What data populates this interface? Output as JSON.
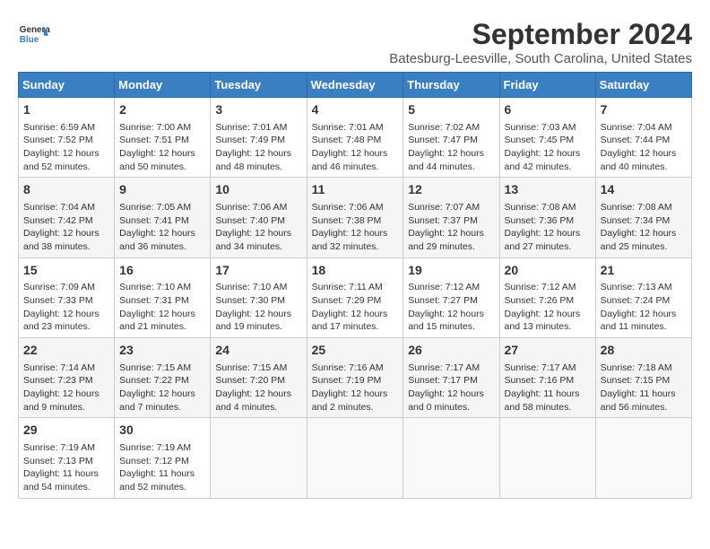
{
  "header": {
    "logo_line1": "General",
    "logo_line2": "Blue",
    "title": "September 2024",
    "subtitle": "Batesburg-Leesville, South Carolina, United States"
  },
  "days_of_week": [
    "Sunday",
    "Monday",
    "Tuesday",
    "Wednesday",
    "Thursday",
    "Friday",
    "Saturday"
  ],
  "weeks": [
    [
      {
        "day": "1",
        "info": "Sunrise: 6:59 AM\nSunset: 7:52 PM\nDaylight: 12 hours\nand 52 minutes."
      },
      {
        "day": "2",
        "info": "Sunrise: 7:00 AM\nSunset: 7:51 PM\nDaylight: 12 hours\nand 50 minutes."
      },
      {
        "day": "3",
        "info": "Sunrise: 7:01 AM\nSunset: 7:49 PM\nDaylight: 12 hours\nand 48 minutes."
      },
      {
        "day": "4",
        "info": "Sunrise: 7:01 AM\nSunset: 7:48 PM\nDaylight: 12 hours\nand 46 minutes."
      },
      {
        "day": "5",
        "info": "Sunrise: 7:02 AM\nSunset: 7:47 PM\nDaylight: 12 hours\nand 44 minutes."
      },
      {
        "day": "6",
        "info": "Sunrise: 7:03 AM\nSunset: 7:45 PM\nDaylight: 12 hours\nand 42 minutes."
      },
      {
        "day": "7",
        "info": "Sunrise: 7:04 AM\nSunset: 7:44 PM\nDaylight: 12 hours\nand 40 minutes."
      }
    ],
    [
      {
        "day": "8",
        "info": "Sunrise: 7:04 AM\nSunset: 7:42 PM\nDaylight: 12 hours\nand 38 minutes."
      },
      {
        "day": "9",
        "info": "Sunrise: 7:05 AM\nSunset: 7:41 PM\nDaylight: 12 hours\nand 36 minutes."
      },
      {
        "day": "10",
        "info": "Sunrise: 7:06 AM\nSunset: 7:40 PM\nDaylight: 12 hours\nand 34 minutes."
      },
      {
        "day": "11",
        "info": "Sunrise: 7:06 AM\nSunset: 7:38 PM\nDaylight: 12 hours\nand 32 minutes."
      },
      {
        "day": "12",
        "info": "Sunrise: 7:07 AM\nSunset: 7:37 PM\nDaylight: 12 hours\nand 29 minutes."
      },
      {
        "day": "13",
        "info": "Sunrise: 7:08 AM\nSunset: 7:36 PM\nDaylight: 12 hours\nand 27 minutes."
      },
      {
        "day": "14",
        "info": "Sunrise: 7:08 AM\nSunset: 7:34 PM\nDaylight: 12 hours\nand 25 minutes."
      }
    ],
    [
      {
        "day": "15",
        "info": "Sunrise: 7:09 AM\nSunset: 7:33 PM\nDaylight: 12 hours\nand 23 minutes."
      },
      {
        "day": "16",
        "info": "Sunrise: 7:10 AM\nSunset: 7:31 PM\nDaylight: 12 hours\nand 21 minutes."
      },
      {
        "day": "17",
        "info": "Sunrise: 7:10 AM\nSunset: 7:30 PM\nDaylight: 12 hours\nand 19 minutes."
      },
      {
        "day": "18",
        "info": "Sunrise: 7:11 AM\nSunset: 7:29 PM\nDaylight: 12 hours\nand 17 minutes."
      },
      {
        "day": "19",
        "info": "Sunrise: 7:12 AM\nSunset: 7:27 PM\nDaylight: 12 hours\nand 15 minutes."
      },
      {
        "day": "20",
        "info": "Sunrise: 7:12 AM\nSunset: 7:26 PM\nDaylight: 12 hours\nand 13 minutes."
      },
      {
        "day": "21",
        "info": "Sunrise: 7:13 AM\nSunset: 7:24 PM\nDaylight: 12 hours\nand 11 minutes."
      }
    ],
    [
      {
        "day": "22",
        "info": "Sunrise: 7:14 AM\nSunset: 7:23 PM\nDaylight: 12 hours\nand 9 minutes."
      },
      {
        "day": "23",
        "info": "Sunrise: 7:15 AM\nSunset: 7:22 PM\nDaylight: 12 hours\nand 7 minutes."
      },
      {
        "day": "24",
        "info": "Sunrise: 7:15 AM\nSunset: 7:20 PM\nDaylight: 12 hours\nand 4 minutes."
      },
      {
        "day": "25",
        "info": "Sunrise: 7:16 AM\nSunset: 7:19 PM\nDaylight: 12 hours\nand 2 minutes."
      },
      {
        "day": "26",
        "info": "Sunrise: 7:17 AM\nSunset: 7:17 PM\nDaylight: 12 hours\nand 0 minutes."
      },
      {
        "day": "27",
        "info": "Sunrise: 7:17 AM\nSunset: 7:16 PM\nDaylight: 11 hours\nand 58 minutes."
      },
      {
        "day": "28",
        "info": "Sunrise: 7:18 AM\nSunset: 7:15 PM\nDaylight: 11 hours\nand 56 minutes."
      }
    ],
    [
      {
        "day": "29",
        "info": "Sunrise: 7:19 AM\nSunset: 7:13 PM\nDaylight: 11 hours\nand 54 minutes."
      },
      {
        "day": "30",
        "info": "Sunrise: 7:19 AM\nSunset: 7:12 PM\nDaylight: 11 hours\nand 52 minutes."
      },
      {
        "day": "",
        "info": ""
      },
      {
        "day": "",
        "info": ""
      },
      {
        "day": "",
        "info": ""
      },
      {
        "day": "",
        "info": ""
      },
      {
        "day": "",
        "info": ""
      }
    ]
  ]
}
